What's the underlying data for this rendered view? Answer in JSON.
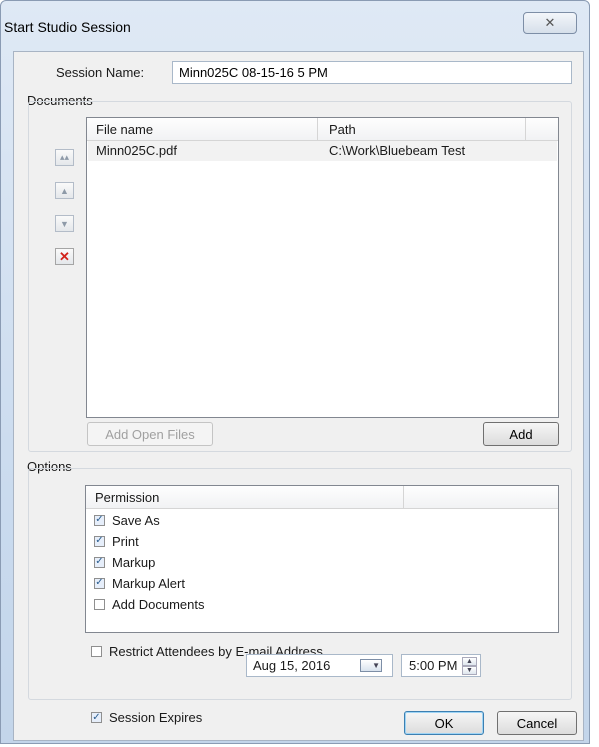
{
  "window": {
    "title": "Start Studio Session",
    "close_glyph": "✕"
  },
  "session": {
    "label": "Session Name:",
    "value": "Minn025C 08-15-16 5 PM"
  },
  "documents": {
    "group_label": "Documents",
    "columns": [
      "File name",
      "Path"
    ],
    "files": [
      {
        "name": "Minn025C.pdf",
        "path": "C:\\Work\\Bluebeam Test"
      }
    ],
    "side_buttons": [
      "move-top-icon",
      "move-up-icon",
      "move-down-icon",
      "delete-icon"
    ],
    "add_open_files_label": "Add Open Files",
    "add_label": "Add"
  },
  "options": {
    "group_label": "Options",
    "permission_header": "Permission",
    "permissions": [
      {
        "label": "Save As",
        "checked": true
      },
      {
        "label": "Print",
        "checked": true
      },
      {
        "label": "Markup",
        "checked": true
      },
      {
        "label": "Markup Alert",
        "checked": true
      },
      {
        "label": "Add Documents",
        "checked": false
      }
    ],
    "restrict": {
      "label": "Restrict Attendees by E-mail Address",
      "checked": false
    },
    "expires": {
      "label": "Session Expires",
      "checked": true,
      "date": "Aug 15, 2016",
      "time": "5:00 PM"
    }
  },
  "buttons": {
    "ok": "OK",
    "cancel": "Cancel"
  },
  "colors": {
    "title_gradient": "#c9daee",
    "client_bg": "#f0f0f0",
    "delete_red": "#d2221a",
    "check_blue": "#2a5d8f"
  }
}
